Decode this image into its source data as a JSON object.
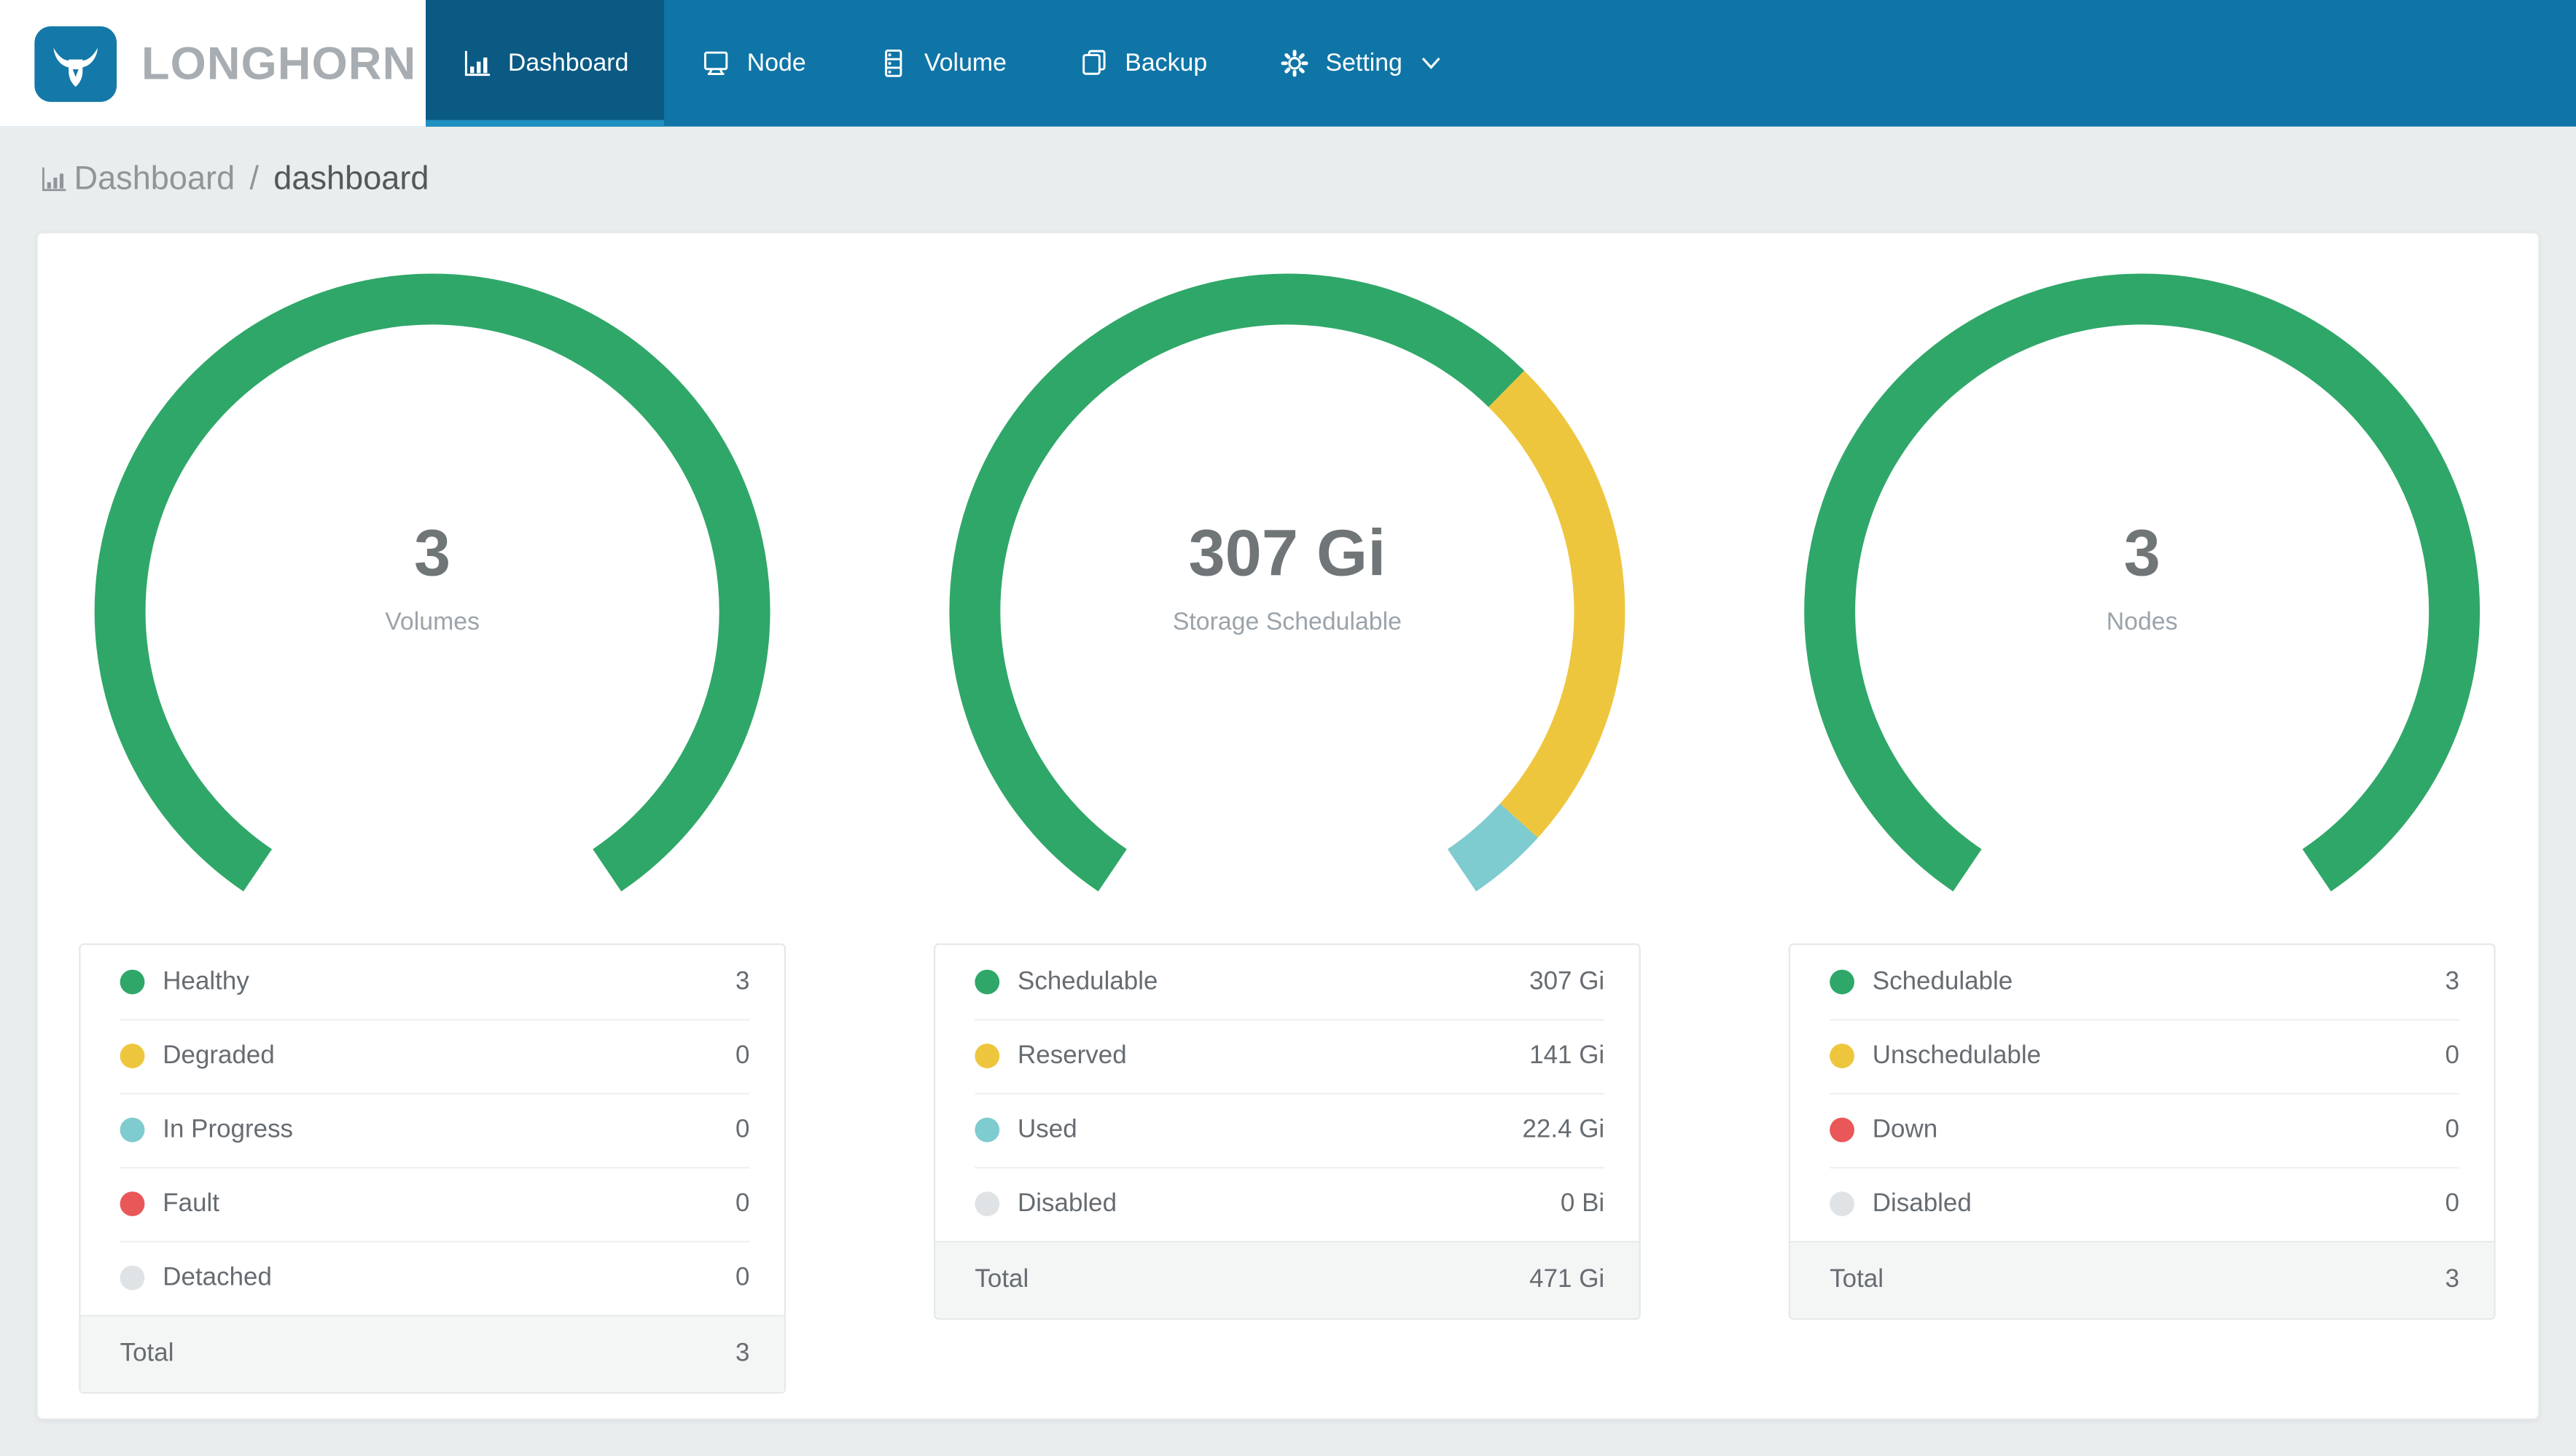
{
  "app": {
    "title": "Longhorn Dashboard"
  },
  "colors": {
    "navbar_bg": "#0f75a6",
    "active_tab_bg": "#0a5a84",
    "active_tab_indicator": "#1f90c2",
    "logo_blue": "#1478a8",
    "logo_text_gray": "#a8adb2",
    "page_bg": "#e9edee",
    "green": "#2fa768",
    "yellow": "#eec63e",
    "teal": "#7ecbd0",
    "red": "#e95758",
    "gray": "#dfe3e5"
  },
  "navbar": {
    "logo_text": "LONGHORN",
    "items": [
      {
        "label": "Dashboard",
        "icon": "bar-chart-icon",
        "active": true
      },
      {
        "label": "Node",
        "icon": "monitor-icon",
        "active": false
      },
      {
        "label": "Volume",
        "icon": "server-icon",
        "active": false
      },
      {
        "label": "Backup",
        "icon": "copy-icon",
        "active": false
      },
      {
        "label": "Setting",
        "icon": "gear-icon",
        "active": false,
        "dropdown": true
      }
    ]
  },
  "breadcrumb": {
    "icon": "bar-chart-icon",
    "section": "Dashboard",
    "separator": "/",
    "current": "dashboard"
  },
  "panels": [
    {
      "gauge": {
        "value": "3",
        "label": "Volumes",
        "segments": [
          {
            "name": "Healthy",
            "value": 3,
            "color": "#2fa768"
          },
          {
            "name": "Degraded",
            "value": 0,
            "color": "#eec63e"
          },
          {
            "name": "In Progress",
            "value": 0,
            "color": "#7ecbd0"
          },
          {
            "name": "Fault",
            "value": 0,
            "color": "#e95758"
          },
          {
            "name": "Detached",
            "value": 0,
            "color": "#dfe3e5"
          }
        ]
      },
      "legend": {
        "rows": [
          {
            "label": "Healthy",
            "value": "3",
            "color": "#2fa768"
          },
          {
            "label": "Degraded",
            "value": "0",
            "color": "#eec63e"
          },
          {
            "label": "In Progress",
            "value": "0",
            "color": "#7ecbd0"
          },
          {
            "label": "Fault",
            "value": "0",
            "color": "#e95758"
          },
          {
            "label": "Detached",
            "value": "0",
            "color": "#dfe3e5"
          }
        ],
        "total_label": "Total",
        "total_value": "3"
      }
    },
    {
      "gauge": {
        "value": "307 Gi",
        "label": "Storage Schedulable",
        "segments": [
          {
            "name": "Schedulable",
            "value": 307,
            "color": "#2fa768"
          },
          {
            "name": "Reserved",
            "value": 141,
            "color": "#eec63e"
          },
          {
            "name": "Used",
            "value": 22.4,
            "color": "#7ecbd0"
          },
          {
            "name": "Disabled",
            "value": 0,
            "color": "#dfe3e5"
          }
        ]
      },
      "legend": {
        "rows": [
          {
            "label": "Schedulable",
            "value": "307 Gi",
            "color": "#2fa768"
          },
          {
            "label": "Reserved",
            "value": "141 Gi",
            "color": "#eec63e"
          },
          {
            "label": "Used",
            "value": "22.4 Gi",
            "color": "#7ecbd0"
          },
          {
            "label": "Disabled",
            "value": "0 Bi",
            "color": "#dfe3e5"
          }
        ],
        "total_label": "Total",
        "total_value": "471 Gi"
      }
    },
    {
      "gauge": {
        "value": "3",
        "label": "Nodes",
        "segments": [
          {
            "name": "Schedulable",
            "value": 3,
            "color": "#2fa768"
          },
          {
            "name": "Unschedulable",
            "value": 0,
            "color": "#eec63e"
          },
          {
            "name": "Down",
            "value": 0,
            "color": "#e95758"
          },
          {
            "name": "Disabled",
            "value": 0,
            "color": "#dfe3e5"
          }
        ]
      },
      "legend": {
        "rows": [
          {
            "label": "Schedulable",
            "value": "3",
            "color": "#2fa768"
          },
          {
            "label": "Unschedulable",
            "value": "0",
            "color": "#eec63e"
          },
          {
            "label": "Down",
            "value": "0",
            "color": "#e95758"
          },
          {
            "label": "Disabled",
            "value": "0",
            "color": "#dfe3e5"
          }
        ],
        "total_label": "Total",
        "total_value": "3"
      }
    }
  ],
  "chart_data": [
    {
      "type": "donut",
      "title": "Volumes",
      "center_value": "3",
      "center_label": "Volumes",
      "labels": [
        "Healthy",
        "Degraded",
        "In Progress",
        "Fault",
        "Detached"
      ],
      "values": [
        3,
        0,
        0,
        0,
        0
      ],
      "colors": [
        "#2fa768",
        "#eec63e",
        "#7ecbd0",
        "#e95758",
        "#dfe3e5"
      ],
      "total": 3,
      "arc_start_deg": 124,
      "arc_sweep_deg": 292
    },
    {
      "type": "donut",
      "title": "Storage Schedulable",
      "center_value": "307 Gi",
      "center_label": "Storage Schedulable",
      "labels": [
        "Schedulable",
        "Reserved",
        "Used",
        "Disabled"
      ],
      "values": [
        307,
        141,
        22.4,
        0
      ],
      "units": [
        "Gi",
        "Gi",
        "Gi",
        "Bi"
      ],
      "colors": [
        "#2fa768",
        "#eec63e",
        "#7ecbd0",
        "#dfe3e5"
      ],
      "total": "471 Gi",
      "arc_start_deg": 124,
      "arc_sweep_deg": 292
    },
    {
      "type": "donut",
      "title": "Nodes",
      "center_value": "3",
      "center_label": "Nodes",
      "labels": [
        "Schedulable",
        "Unschedulable",
        "Down",
        "Disabled"
      ],
      "values": [
        3,
        0,
        0,
        0
      ],
      "colors": [
        "#2fa768",
        "#eec63e",
        "#e95758",
        "#dfe3e5"
      ],
      "total": 3,
      "arc_start_deg": 124,
      "arc_sweep_deg": 292
    }
  ]
}
